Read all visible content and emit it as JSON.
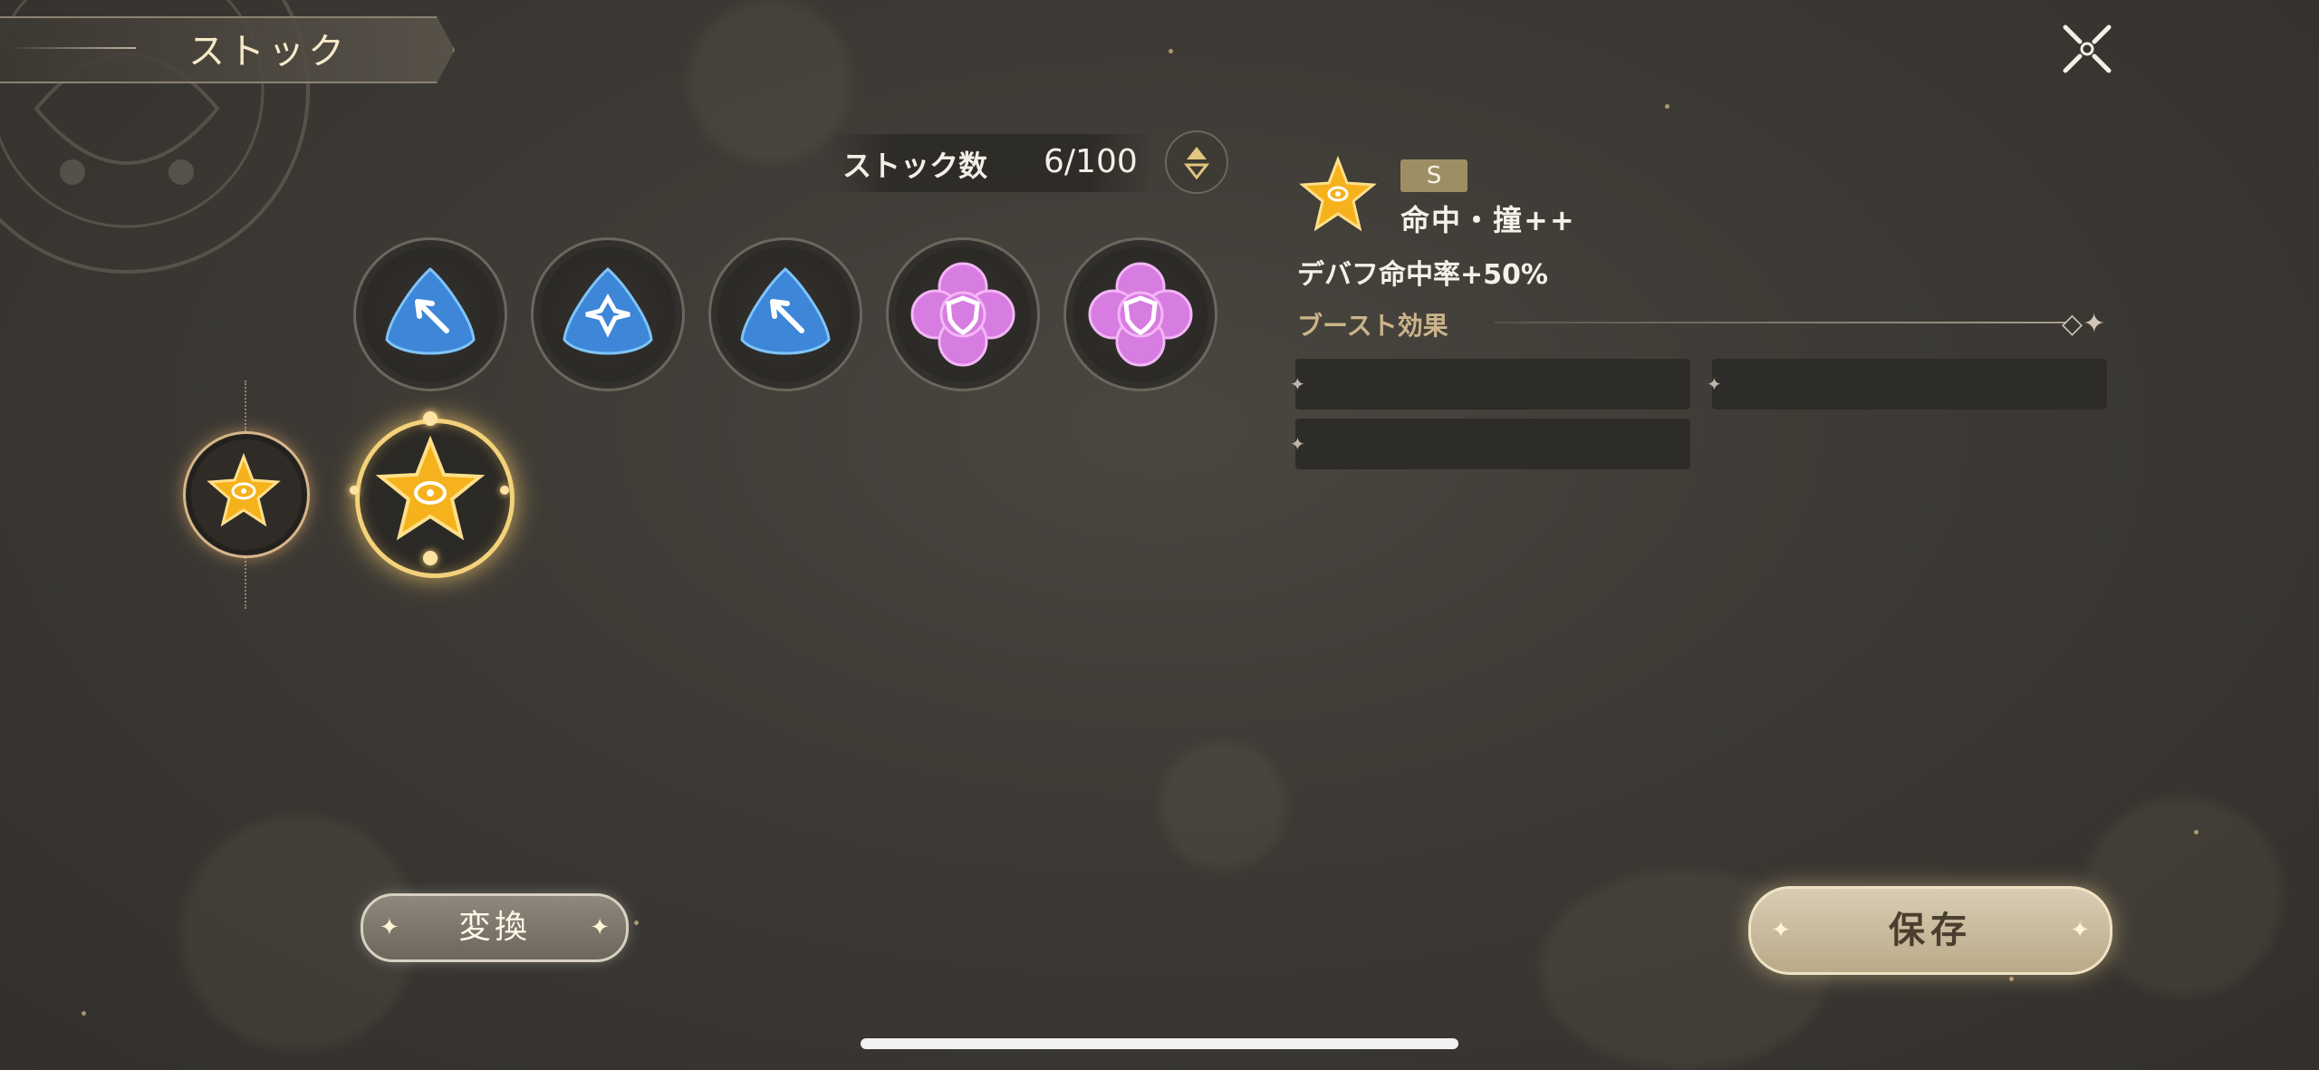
{
  "header": {
    "title": "ストック"
  },
  "stock": {
    "label": "ストック数",
    "count": "6/100"
  },
  "slots": [
    {
      "kind": "blue-triangle",
      "icon": "arrow-icon"
    },
    {
      "kind": "blue-triangle",
      "icon": "shuriken-icon"
    },
    {
      "kind": "blue-triangle",
      "icon": "arrow-icon"
    },
    {
      "kind": "pink-flower",
      "icon": "shield-icon"
    },
    {
      "kind": "pink-flower",
      "icon": "shield-icon"
    }
  ],
  "detail": {
    "rank": "S",
    "name": "命中・撞++",
    "effect": "デバフ命中率+50%",
    "boost_label": "ブースト効果"
  },
  "buttons": {
    "convert": "変換",
    "save": "保存"
  },
  "colors": {
    "gold_star": "#f5b21c",
    "blue_gem": "#3d86d8",
    "pink_gem": "#d77ce0",
    "accent_gold": "#f3d27a",
    "rank_badge": "#9e8e64"
  }
}
